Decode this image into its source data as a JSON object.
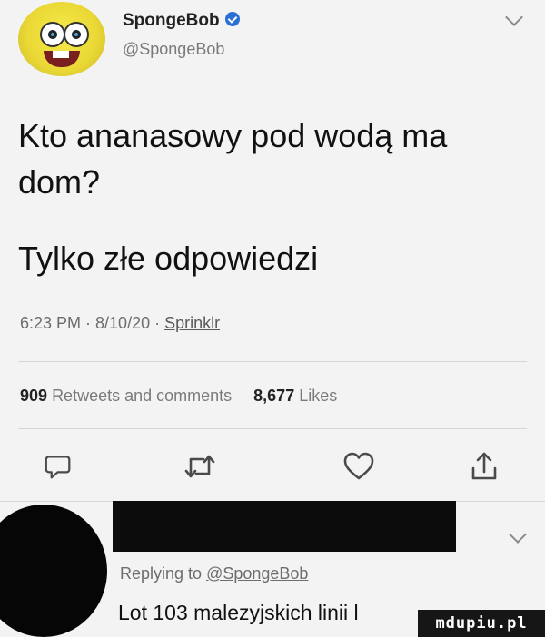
{
  "header": {
    "display_name": "SpongeBob",
    "handle": "@SpongeBob"
  },
  "tweet": {
    "line1": "Kto ananasowy pod wodą ma dom?",
    "line2": "Tylko złe odpowiedzi",
    "timestamp": "6:23 PM · 8/10/20 · ",
    "source": "Sprinklr"
  },
  "stats": {
    "retweets_count": "909",
    "retweets_label": "Retweets and comments",
    "likes_count": "8,677",
    "likes_label": "Likes"
  },
  "actions": [
    "reply-icon",
    "retweet-icon",
    "like-icon",
    "share-icon"
  ],
  "reply": {
    "replying_prefix": "Replying to ",
    "replying_mention": "@SpongeBob",
    "text": "Lot 103 malezyjskich linii l"
  },
  "watermark": "mdupiu.pl",
  "colors": {
    "background": "#f3f3f3",
    "verified": "#2a6fd6",
    "secondary_text": "#6d6d6d"
  }
}
